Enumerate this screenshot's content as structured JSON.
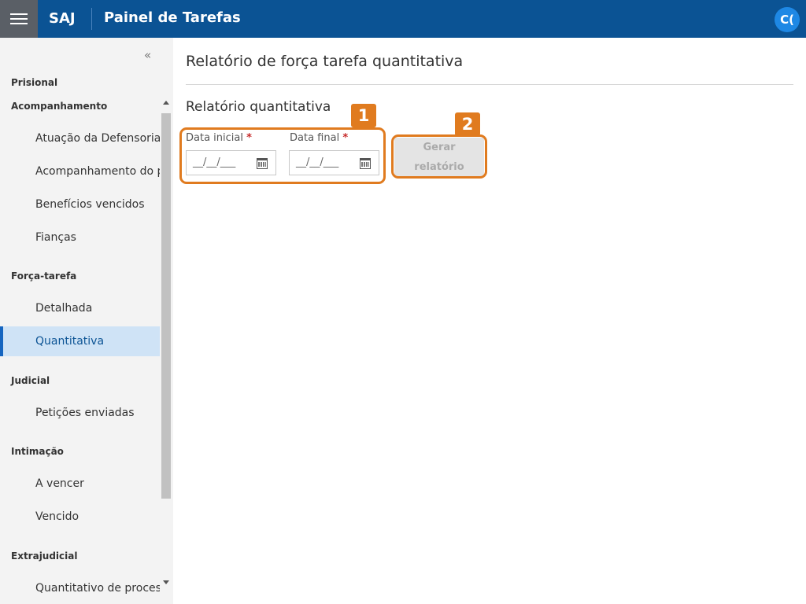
{
  "header": {
    "app_name": "SAJ",
    "title": "Painel de Tarefas",
    "avatar_initials": "C(",
    "brand_color": "#0b5394"
  },
  "sidebar": {
    "collapse_icon": "«",
    "sections": [
      {
        "label": "Prisional"
      },
      {
        "label": "Acompanhamento",
        "items": [
          "Atuação da Defensoria",
          "Acompanhamento do pre",
          "Benefícios vencidos",
          "Fianças"
        ]
      },
      {
        "label": "Força-tarefa",
        "items": [
          "Detalhada",
          "Quantitativa"
        ]
      },
      {
        "label": "Judicial",
        "items": [
          "Petições enviadas"
        ]
      },
      {
        "label": "Intimação",
        "items": [
          "A vencer",
          "Vencido"
        ]
      },
      {
        "label": "Extrajudicial",
        "items": [
          "Quantitativo de processo"
        ]
      }
    ],
    "active_item": "Quantitativa"
  },
  "main": {
    "title": "Relatório de força tarefa quantitativa",
    "subtitle": "Relatório quantitativa",
    "fields": {
      "start_label": "Data inicial",
      "end_label": "Data final",
      "required_marker": "*",
      "start_placeholder": "__/__/___",
      "end_placeholder": "__/__/___"
    },
    "generate_button": {
      "line1": "Gerar",
      "line2": "relatório"
    }
  },
  "annotations": [
    {
      "number": "1"
    },
    {
      "number": "2"
    }
  ],
  "colors": {
    "annotation": "#e07b1f",
    "active_item_bg": "#cfe3f6"
  }
}
